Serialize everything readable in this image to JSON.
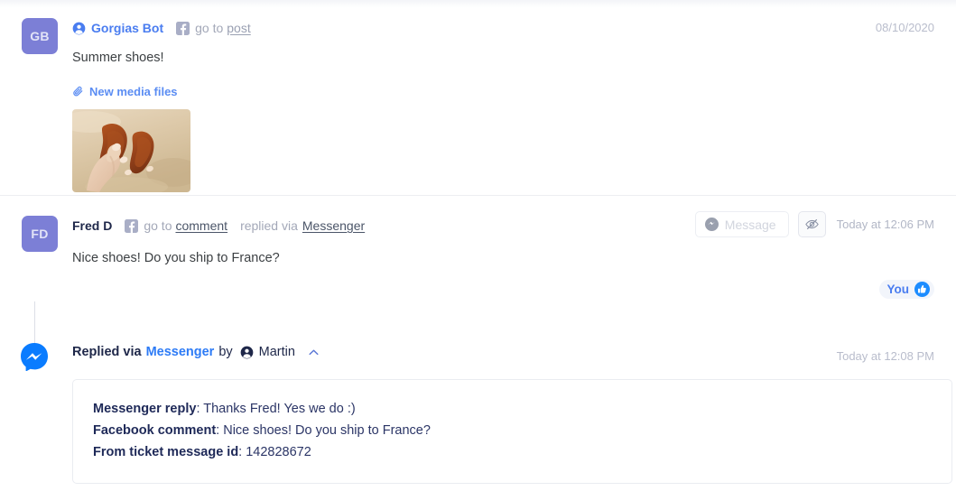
{
  "colors": {
    "avatar_bg": "#7c7fd6",
    "link_blue": "#4a7df0",
    "messenger_blue": "#0084ff",
    "muted": "#a3a8b8",
    "card_border": "#eaecf1",
    "detail_text": "#2b3566"
  },
  "messages": [
    {
      "avatar_initials": "GB",
      "author": "Gorgias Bot",
      "channel_icon": "facebook-icon",
      "link_prefix": "go to",
      "link_label": "post",
      "timestamp": "08/10/2020",
      "text": "Summer shoes!",
      "attachment_label": "New media files",
      "attachment_icon": "paperclip-icon",
      "thumbnail_alt": "brown sandals on sand"
    },
    {
      "avatar_initials": "FD",
      "author": "Fred D",
      "channel_icon": "facebook-icon",
      "link_prefix": "go to",
      "link_label": "comment",
      "via_prefix": "replied via",
      "via_label": "Messenger",
      "message_button_label": "Message",
      "message_button_icon": "messenger-icon",
      "hide_button_icon": "eye-slash-icon",
      "timestamp": "Today at 12:06 PM",
      "text": "Nice shoes! Do you ship to France?",
      "reaction": {
        "label": "You",
        "icon": "thumbs-up-icon"
      }
    }
  ],
  "reply": {
    "icon": "messenger-icon",
    "prefix": "Replied via",
    "channel": "Messenger",
    "by_word": "by",
    "agent_icon": "person-icon",
    "agent": "Martin",
    "collapse_icon": "chevron-up-icon",
    "timestamp": "Today at 12:08 PM",
    "details": [
      {
        "label": "Messenger reply",
        "value": "Thanks Fred! Yes we do :)"
      },
      {
        "label": "Facebook comment",
        "value": "Nice shoes! Do you ship to France?"
      },
      {
        "label": "From ticket message id",
        "value": "142828672"
      }
    ]
  }
}
